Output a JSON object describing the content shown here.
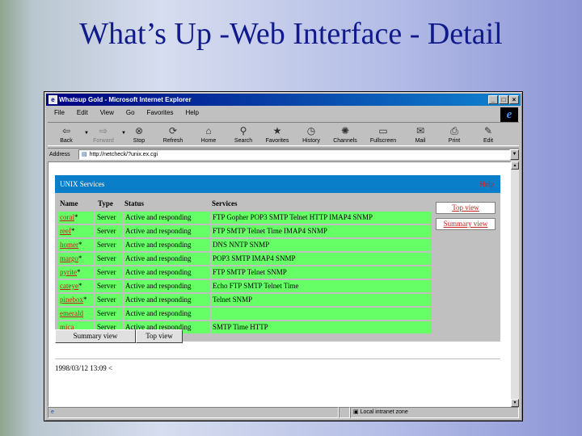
{
  "slide": {
    "title": "What’s Up -Web Interface - Detail"
  },
  "window": {
    "title": "Whatsup Gold - Microsoft Internet Explorer",
    "minimize": "_",
    "maximize": "□",
    "close": "×"
  },
  "menu": [
    "File",
    "Edit",
    "View",
    "Go",
    "Favorites",
    "Help"
  ],
  "toolbar": [
    {
      "label": "Back",
      "icon": "back-arrow-icon",
      "glyph": "⇦",
      "disabled": false,
      "dropdown": true
    },
    {
      "label": "Forward",
      "icon": "forward-arrow-icon",
      "glyph": "⇨",
      "disabled": true,
      "dropdown": true
    },
    {
      "label": "Stop",
      "icon": "stop-icon",
      "glyph": "⊗",
      "disabled": false,
      "dropdown": false
    },
    {
      "label": "Refresh",
      "icon": "refresh-icon",
      "glyph": "⟳",
      "disabled": false,
      "dropdown": false
    },
    {
      "label": "Home",
      "icon": "home-icon",
      "glyph": "⌂",
      "disabled": false,
      "dropdown": false
    },
    {
      "label": "Search",
      "icon": "search-icon",
      "glyph": "⚲",
      "disabled": false,
      "dropdown": false
    },
    {
      "label": "Favorites",
      "icon": "favorites-icon",
      "glyph": "★",
      "disabled": false,
      "dropdown": false
    },
    {
      "label": "History",
      "icon": "history-icon",
      "glyph": "◷",
      "disabled": false,
      "dropdown": false
    },
    {
      "label": "Channels",
      "icon": "channels-icon",
      "glyph": "✺",
      "disabled": false,
      "dropdown": false
    },
    {
      "label": "Fullscreen",
      "icon": "fullscreen-icon",
      "glyph": "▭",
      "disabled": false,
      "dropdown": false
    },
    {
      "label": "Mail",
      "icon": "mail-icon",
      "glyph": "✉",
      "disabled": false,
      "dropdown": false
    },
    {
      "label": "Print",
      "icon": "print-icon",
      "glyph": "⎙",
      "disabled": false,
      "dropdown": false
    },
    {
      "label": "Edit",
      "icon": "edit-icon",
      "glyph": "✎",
      "disabled": false,
      "dropdown": false
    }
  ],
  "address": {
    "label": "Address",
    "value": "http://netcheck/?unix.ex.cgi"
  },
  "panel": {
    "title": "UNIX Services",
    "help": "Help",
    "columns": {
      "name": "Name",
      "type": "Type",
      "status": "Status",
      "services": "Services"
    },
    "rows": [
      {
        "name": "coral",
        "mark": "*",
        "type": "Server",
        "status": "Active and responding",
        "services": "FTP Gopher POP3 SMTP Telnet HTTP IMAP4 SNMP"
      },
      {
        "name": "reef",
        "mark": "*",
        "type": "Server",
        "status": "Active and responding",
        "services": "FTP SMTP Telnet Time IMAP4 SNMP"
      },
      {
        "name": "homer",
        "mark": "*",
        "type": "Server",
        "status": "Active and responding",
        "services": "DNS NNTP SNMP"
      },
      {
        "name": "margo",
        "mark": "*",
        "type": "Server",
        "status": "Active and responding",
        "services": "POP3 SMTP IMAP4 SNMP"
      },
      {
        "name": "pyrite",
        "mark": "*",
        "type": "Server",
        "status": "Active and responding",
        "services": "FTP SMTP Telnet SNMP"
      },
      {
        "name": "cateye",
        "mark": "*",
        "type": "Server",
        "status": "Active and responding",
        "services": "Echo FTP SMTP Telnet Time"
      },
      {
        "name": "pinebox",
        "mark": "*",
        "type": "Server",
        "status": "Active and responding",
        "services": "Telnet SNMP"
      },
      {
        "name": "emerald",
        "mark": "",
        "type": "Server",
        "status": "Active and responding",
        "services": ""
      },
      {
        "name": "mica",
        "mark": "",
        "type": "Server",
        "status": "Active and responding",
        "services": "SMTP Time HTTP"
      }
    ],
    "side_links": {
      "top_view": "Top view",
      "summary_view": "Summary view"
    },
    "buttons": {
      "summary_view": "Summary view",
      "top_view": "Top view"
    }
  },
  "timestamp": "1998/03/12 13:09 <",
  "status": {
    "zone": "Local intranet zone"
  }
}
